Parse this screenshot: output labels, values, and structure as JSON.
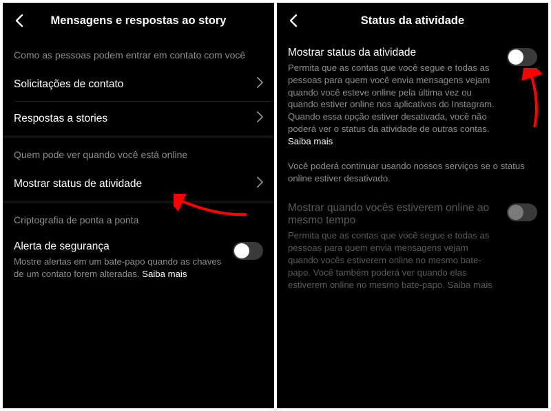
{
  "left": {
    "title": "Mensagens e respostas ao story",
    "section1_header": "Como as pessoas podem entrar em contato com você",
    "row_contact": "Solicitações de contato",
    "row_stories": "Respostas a stories",
    "section2_header": "Quem pode ver quando você está online",
    "row_activity": "Mostrar status de atividade",
    "section3_header": "Criptografia de ponta a ponta",
    "toggle_security_title": "Alerta de segurança",
    "toggle_security_desc": "Mostre alertas em um bate-papo quando as chaves de um contato forem alteradas. ",
    "more": "Saiba mais"
  },
  "right": {
    "title": "Status da atividade",
    "toggle1_title": "Mostrar status da atividade",
    "toggle1_desc": "Permita que as contas que você segue e todas as pessoas para quem você envia mensagens vejam quando você esteve online pela última vez ou quando estiver online nos aplicativos do Instagram. Quando essa opção estiver desativada, você não poderá ver o status da atividade de outras contas. ",
    "more1": "Saiba mais",
    "note": "Você poderá continuar usando nossos serviços se o status online estiver desativado.",
    "toggle2_title": "Mostrar quando vocês estiverem online ao mesmo tempo",
    "toggle2_desc": "Permita que as contas que você segue e todas as pessoas para quem envia mensagens vejam quando vocês estiverem online no mesmo bate-papo. Você também poderá ver quando elas estiverem online no mesmo bate-papo. ",
    "more2": "Saiba mais"
  }
}
